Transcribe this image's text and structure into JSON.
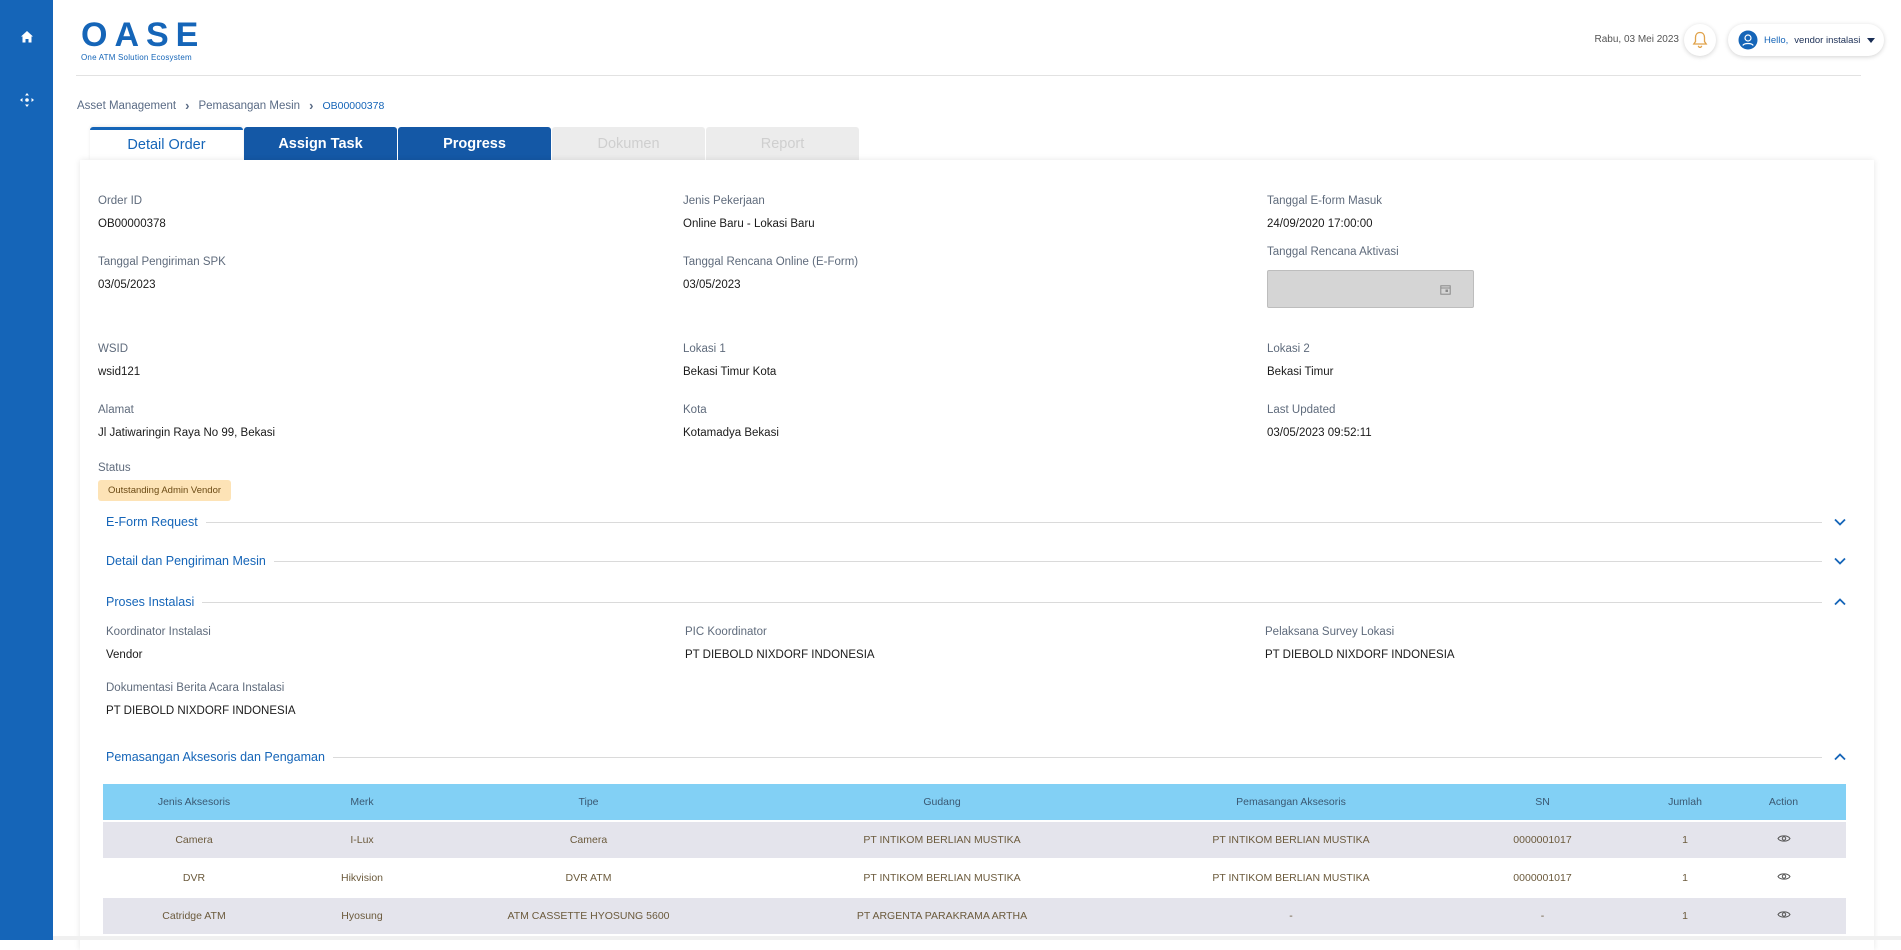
{
  "sidebar": {
    "icons": [
      "home-icon",
      "move-icon"
    ],
    "color": "#1565b8"
  },
  "header": {
    "logo": "OASE",
    "logo_subtitle": "One ATM Solution Ecosystem",
    "date": "Rabu, 03 Mei 2023",
    "greeting": "Hello,",
    "username": "vendor instalasi"
  },
  "breadcrumb": [
    "Asset Management",
    "Pemasangan Mesin",
    "OB00000378"
  ],
  "tabs": [
    {
      "label": "Detail Order",
      "state": "active"
    },
    {
      "label": "Assign Task",
      "state": "enabled"
    },
    {
      "label": "Progress",
      "state": "enabled"
    },
    {
      "label": "Dokumen",
      "state": "disabled"
    },
    {
      "label": "Report",
      "state": "disabled"
    }
  ],
  "details": {
    "order_id": {
      "label": "Order ID",
      "value": "OB00000378"
    },
    "jenis_pekerjaan": {
      "label": "Jenis Pekerjaan",
      "value": "Online Baru - Lokasi Baru"
    },
    "tanggal_eform": {
      "label": "Tanggal E-form Masuk",
      "value": "24/09/2020 17:00:00"
    },
    "tanggal_spk": {
      "label": "Tanggal Pengiriman SPK",
      "value": "03/05/2023"
    },
    "tanggal_rencana_online": {
      "label": "Tanggal Rencana Online (E-Form)",
      "value": "03/05/2023"
    },
    "tanggal_rencana_aktivasi": {
      "label": "Tanggal Rencana Aktivasi",
      "value": ""
    },
    "wsid": {
      "label": "WSID",
      "value": "wsid121"
    },
    "lokasi1": {
      "label": "Lokasi 1",
      "value": "Bekasi Timur Kota"
    },
    "lokasi2": {
      "label": "Lokasi 2",
      "value": "Bekasi Timur"
    },
    "alamat": {
      "label": "Alamat",
      "value": "Jl Jatiwaringin Raya No 99, Bekasi"
    },
    "kota": {
      "label": "Kota",
      "value": "Kotamadya Bekasi"
    },
    "last_updated": {
      "label": "Last Updated",
      "value": "03/05/2023 09:52:11"
    },
    "status": {
      "label": "Status",
      "value": "Outstanding Admin Vendor"
    }
  },
  "sections": {
    "eform": {
      "title": "E-Form Request",
      "expanded": false
    },
    "detail_mesin": {
      "title": "Detail dan Pengiriman Mesin",
      "expanded": false
    },
    "proses_instalasi": {
      "title": "Proses Instalasi",
      "expanded": true
    },
    "aksesoris": {
      "title": "Pemasangan Aksesoris dan Pengaman",
      "expanded": true
    }
  },
  "instalasi": {
    "koordinator": {
      "label": "Koordinator Instalasi",
      "value": "Vendor"
    },
    "pic": {
      "label": "PIC Koordinator",
      "value": "PT DIEBOLD NIXDORF INDONESIA"
    },
    "survey": {
      "label": "Pelaksana Survey Lokasi",
      "value": "PT DIEBOLD NIXDORF INDONESIA"
    },
    "dokumentasi": {
      "label": "Dokumentasi Berita Acara Instalasi",
      "value": "PT DIEBOLD NIXDORF INDONESIA"
    }
  },
  "table": {
    "headers": [
      "Jenis Aksesoris",
      "Merk",
      "Tipe",
      "Gudang",
      "Pemasangan Aksesoris",
      "SN",
      "Jumlah",
      "Action"
    ],
    "rows": [
      [
        "Camera",
        "I-Lux",
        "Camera",
        "PT INTIKOM BERLIAN MUSTIKA",
        "PT INTIKOM BERLIAN MUSTIKA",
        "0000001017",
        "1"
      ],
      [
        "DVR",
        "Hikvision",
        "DVR ATM",
        "PT INTIKOM BERLIAN MUSTIKA",
        "PT INTIKOM BERLIAN MUSTIKA",
        "0000001017",
        "1"
      ],
      [
        "Catridge ATM",
        "Hyosung",
        "ATM CASSETTE HYOSUNG 5600",
        "PT ARGENTA PARAKRAMA ARTHA",
        "-",
        "-",
        "1"
      ]
    ]
  }
}
